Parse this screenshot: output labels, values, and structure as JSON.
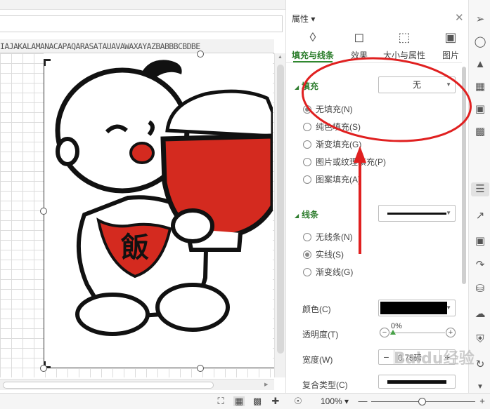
{
  "col_header_text": "IAJAKALAMANACAPAQARASATAUAVAWAXAYAZBABBBCBDBE",
  "stamp_char": "飯",
  "panel": {
    "title": "属性 ▾",
    "close_glyph": "✕",
    "tabs": [
      {
        "label": "填充与线条",
        "icon": "fill-line-icon",
        "active": true
      },
      {
        "label": "效果",
        "icon": "effects-icon",
        "active": false
      },
      {
        "label": "大小与属性",
        "icon": "size-properties-icon",
        "active": false
      },
      {
        "label": "图片",
        "icon": "picture-icon",
        "active": false
      }
    ],
    "fill": {
      "heading": "填充",
      "dropdown_value": "无",
      "options": [
        {
          "label": "无填充(N)",
          "selected": true
        },
        {
          "label": "纯色填充(S)",
          "selected": false
        },
        {
          "label": "渐变填充(G)",
          "selected": false
        },
        {
          "label": "图片或纹理填充(P)",
          "selected": false
        },
        {
          "label": "图案填充(A)",
          "selected": false
        }
      ]
    },
    "line": {
      "heading": "线条",
      "options": [
        {
          "label": "无线条(N)",
          "selected": false
        },
        {
          "label": "实线(S)",
          "selected": true
        },
        {
          "label": "渐变线(G)",
          "selected": false
        }
      ]
    },
    "properties": {
      "color_label": "颜色(C)",
      "color_value": "#000000",
      "transparency_label": "透明度(T)",
      "transparency_value": "0%",
      "width_label": "宽度(W)",
      "width_value": "0.75磅",
      "compound_label": "复合类型(C)"
    }
  },
  "status_bar": {
    "zoom": "100% ▾",
    "minus": "—",
    "plus": "+"
  },
  "watermark": "Baidu经验",
  "annotation_color": "#e02020"
}
